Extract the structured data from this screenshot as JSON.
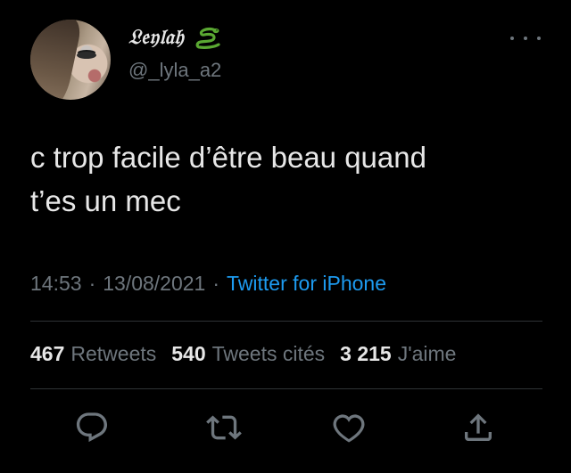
{
  "user": {
    "display_name": "𝔏𝔢𝔶𝔩𝔞𝔥",
    "name_emoji": "snake-icon",
    "handle": "@_lyla_a2"
  },
  "tweet": {
    "text": "c trop facile d’être beau quand\nt’es un mec",
    "time": "14:53",
    "date": "13/08/2021",
    "separator": "·",
    "source": "Twitter for iPhone"
  },
  "stats": {
    "retweets_count": "467",
    "retweets_label": "Retweets",
    "quotes_count": "540",
    "quotes_label": "Tweets cités",
    "likes_count": "3 215",
    "likes_label": "J'aime"
  },
  "actions": [
    "reply-icon",
    "retweet-icon",
    "like-icon",
    "share-icon"
  ],
  "colors": {
    "background": "#000000",
    "text": "#e7e7e7",
    "muted": "#6e767d",
    "link": "#1d9bf0",
    "divider": "#2f3336",
    "snake": "#5aa832"
  }
}
